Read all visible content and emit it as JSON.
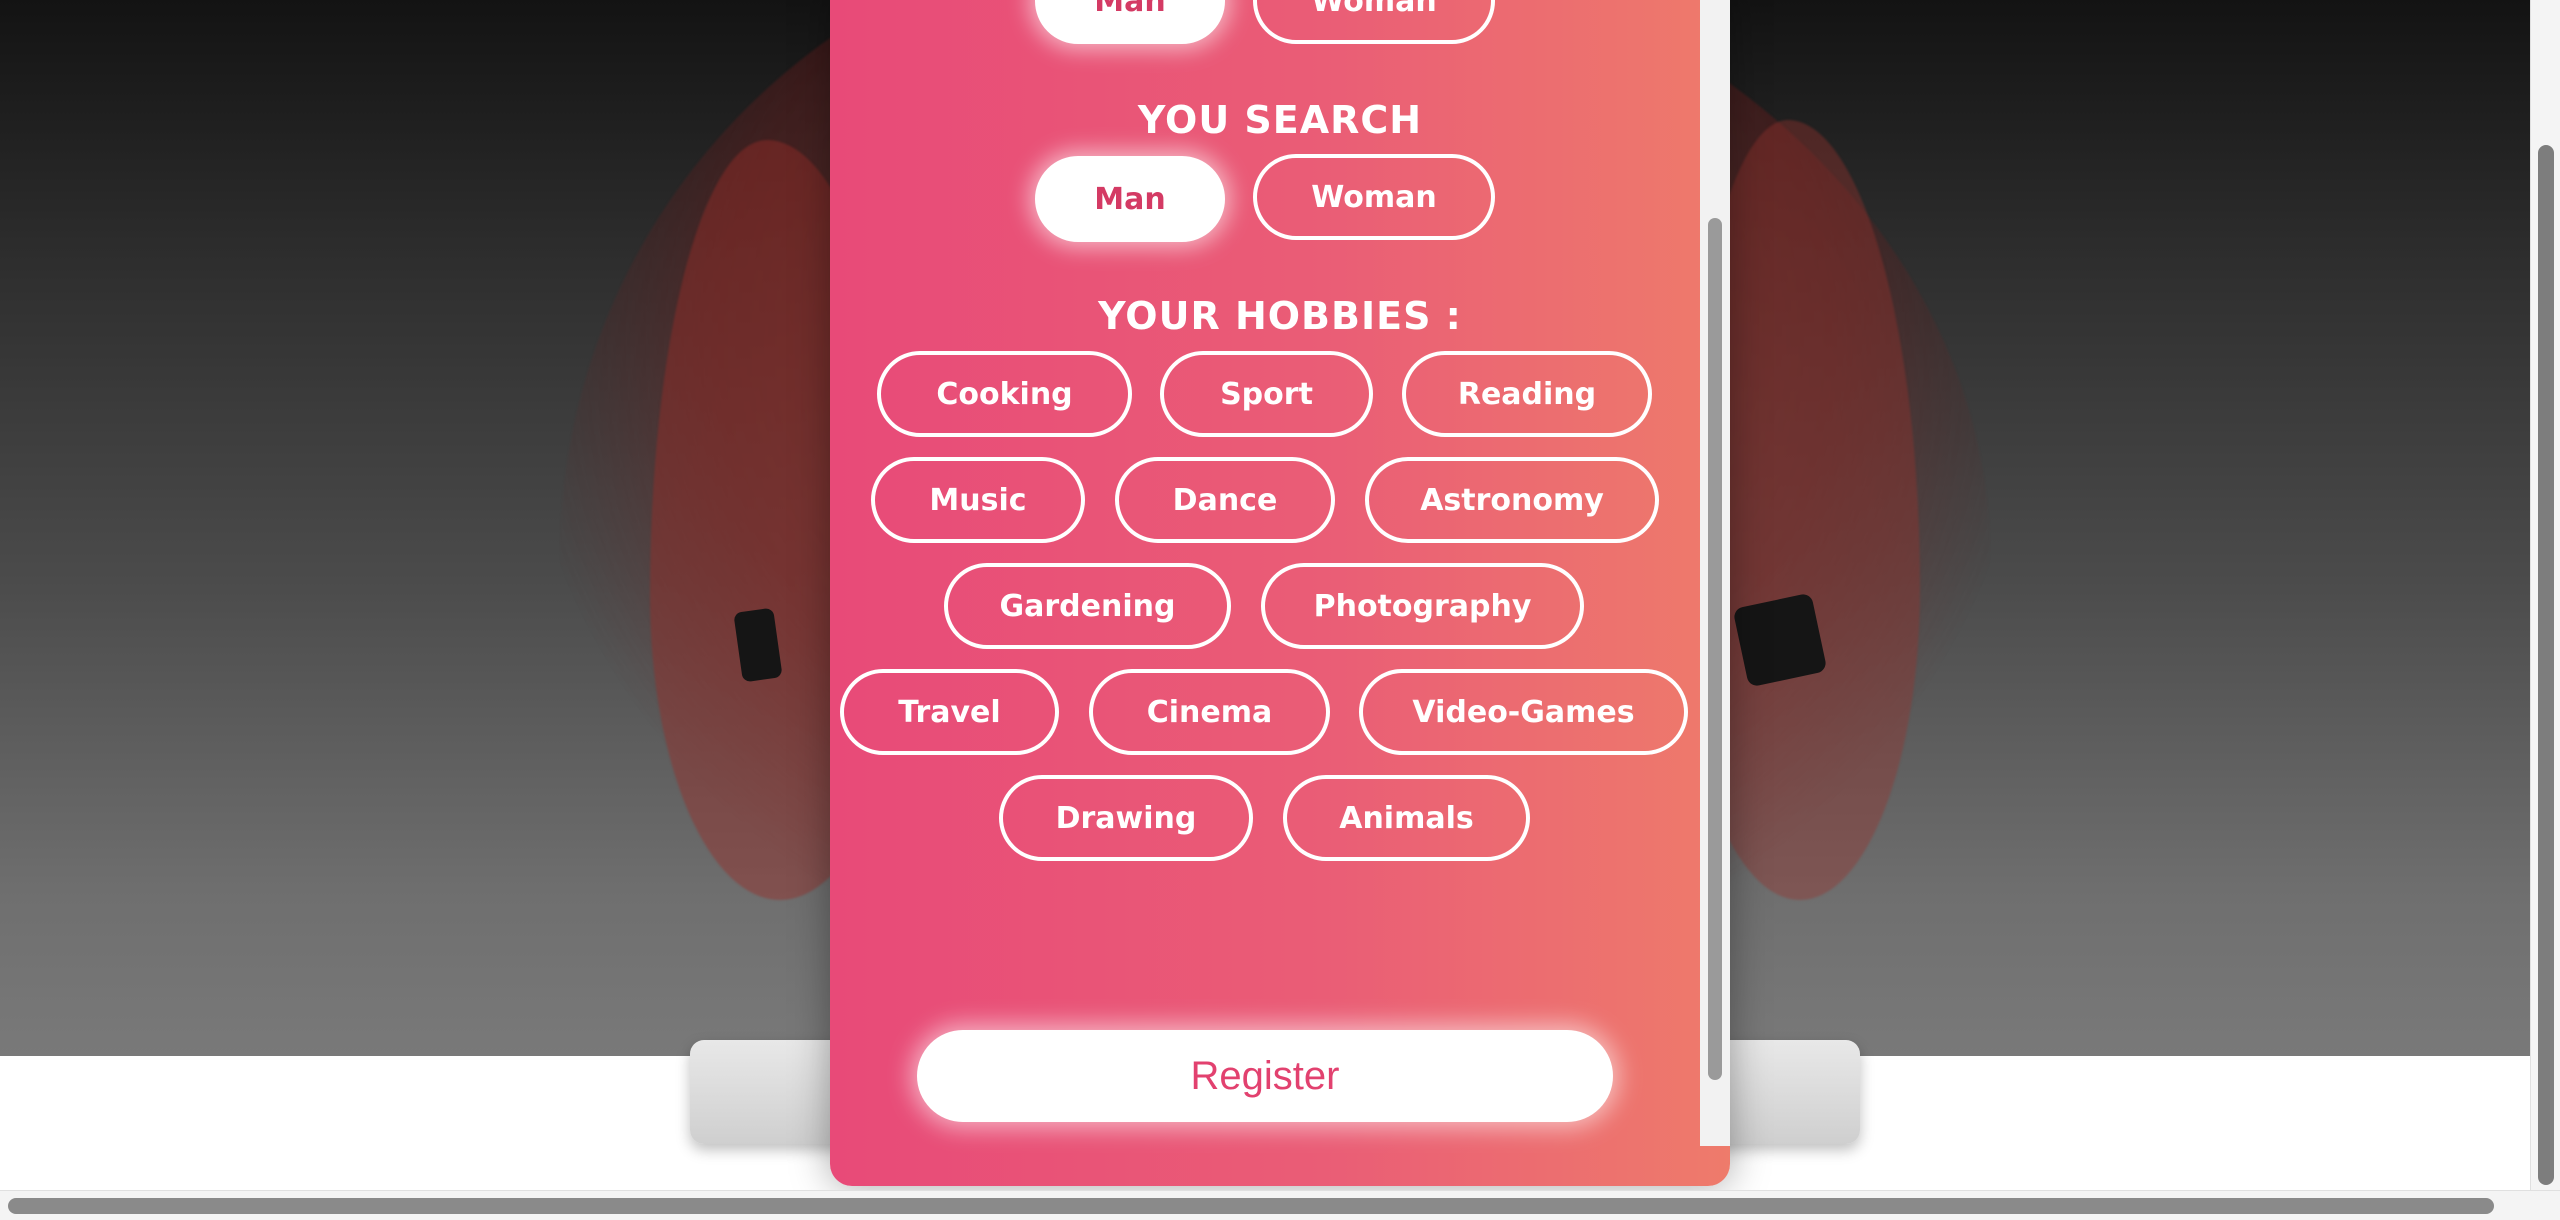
{
  "gender": {
    "options": [
      "Man",
      "Woman"
    ],
    "selected": "Man"
  },
  "search": {
    "heading": "YOU SEARCH",
    "options": [
      "Man",
      "Woman"
    ],
    "selected": "Man"
  },
  "hobbies": {
    "heading": "YOUR HOBBIES :",
    "items": [
      "Cooking",
      "Sport",
      "Reading",
      "Music",
      "Dance",
      "Astronomy",
      "Gardening",
      "Photography",
      "Travel",
      "Cinema",
      "Video-Games",
      "Drawing",
      "Animals"
    ]
  },
  "register_label": "Register",
  "colors": {
    "accent": "#e84a78",
    "accent_end": "#ee7b6b",
    "selected_text": "#d43a64"
  }
}
